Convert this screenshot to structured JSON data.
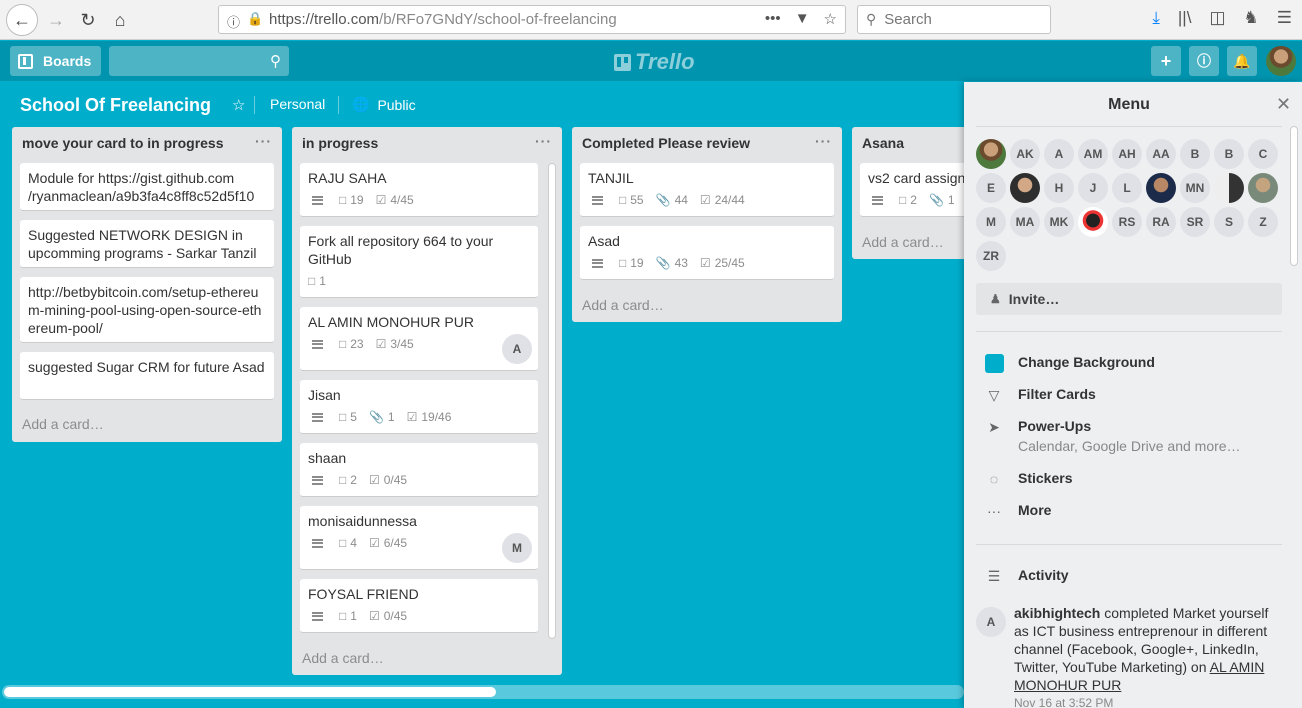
{
  "browser": {
    "url_main": "https://trello.com",
    "url_rest": "/b/RFo7GNdY/school-of-freelancing",
    "search_placeholder": "Search"
  },
  "header": {
    "boards_label": "Boards",
    "logo_text": "Trello"
  },
  "board": {
    "title": "School Of Freelancing",
    "visibility_team": "Personal",
    "visibility": "Public"
  },
  "lists": [
    {
      "title": "move your card to in progress",
      "cards": [
        {
          "title": "Module for https://gist.github.com /ryanmaclean/a9b3fa4c8ff8c52d5f10"
        },
        {
          "title": "Suggested NETWORK DESIGN in upcomming programs - Sarkar Tanzil"
        },
        {
          "title": "http://betbybitcoin.com/setup-ethereum-mining-pool-using-open-source-ethereum-pool/"
        },
        {
          "title": "suggested Sugar CRM for future Asad"
        }
      ],
      "add_card": "Add a card…"
    },
    {
      "title": "in progress",
      "cards": [
        {
          "title": "RAJU SAHA",
          "comments": "19",
          "checklist": "4/45"
        },
        {
          "title": "Fork all repository 664 to your GitHub",
          "comments": "1"
        },
        {
          "title": "AL AMIN MONOHUR PUR",
          "comments": "23",
          "checklist": "3/45",
          "member": "A"
        },
        {
          "title": "Jisan",
          "comments": "5",
          "attachments": "1",
          "checklist": "19/46"
        },
        {
          "title": "shaan",
          "comments": "2",
          "checklist": "0/45"
        },
        {
          "title": "monisaidunnessa",
          "comments": "4",
          "checklist": "6/45",
          "member": "M"
        },
        {
          "title": "FOYSAL FRIEND",
          "comments": "1",
          "checklist": "0/45"
        }
      ],
      "add_card": "Add a card…"
    },
    {
      "title": "Completed Please review",
      "cards": [
        {
          "title": "TANJIL",
          "comments": "55",
          "attachments": "44",
          "checklist": "24/44"
        },
        {
          "title": "Asad",
          "comments": "19",
          "attachments": "43",
          "checklist": "25/45"
        }
      ],
      "add_card": "Add a card…"
    },
    {
      "title": "Asana",
      "cards": [
        {
          "title": "vs2 card assign",
          "comments": "2",
          "attachments": "1"
        }
      ],
      "add_card": "Add a card…"
    }
  ],
  "menu": {
    "title": "Menu",
    "members": [
      "",
      "AK",
      "A",
      "AM",
      "AH",
      "AA",
      "B",
      "B",
      "C",
      "E",
      "",
      "H",
      "J",
      "L",
      "",
      "MN",
      "",
      "",
      "M",
      "MA",
      "MK",
      "",
      "RS",
      "RA",
      "SR",
      "S",
      "Z",
      "ZR"
    ],
    "invite_label": "Invite…",
    "items": [
      {
        "label": "Change Background",
        "icon": "background-swatch"
      },
      {
        "label": "Filter Cards",
        "icon": "filter-icon"
      },
      {
        "label": "Power-Ups",
        "sub": "Calendar, Google Drive and more…",
        "icon": "paper-plane-icon"
      },
      {
        "label": "Stickers",
        "icon": "sticker-icon"
      },
      {
        "label": "More",
        "icon": "ellipsis-icon"
      }
    ],
    "activity_label": "Activity",
    "activity": {
      "avatar": "A",
      "user": "akibhightech",
      "text": " completed Market yourself as ICT business entreprenour in different channel (Facebook, Google+, LinkedIn, Twitter, YouTube Marketing) on ",
      "link": "AL AMIN MONOHUR PUR",
      "time": "Nov 16 at 3:52 PM"
    }
  },
  "colors": {
    "board_bg": "#00aecc",
    "header_bg": "#0094ae",
    "list_bg": "#e2e4e6",
    "menu_bg": "#edeff0"
  }
}
